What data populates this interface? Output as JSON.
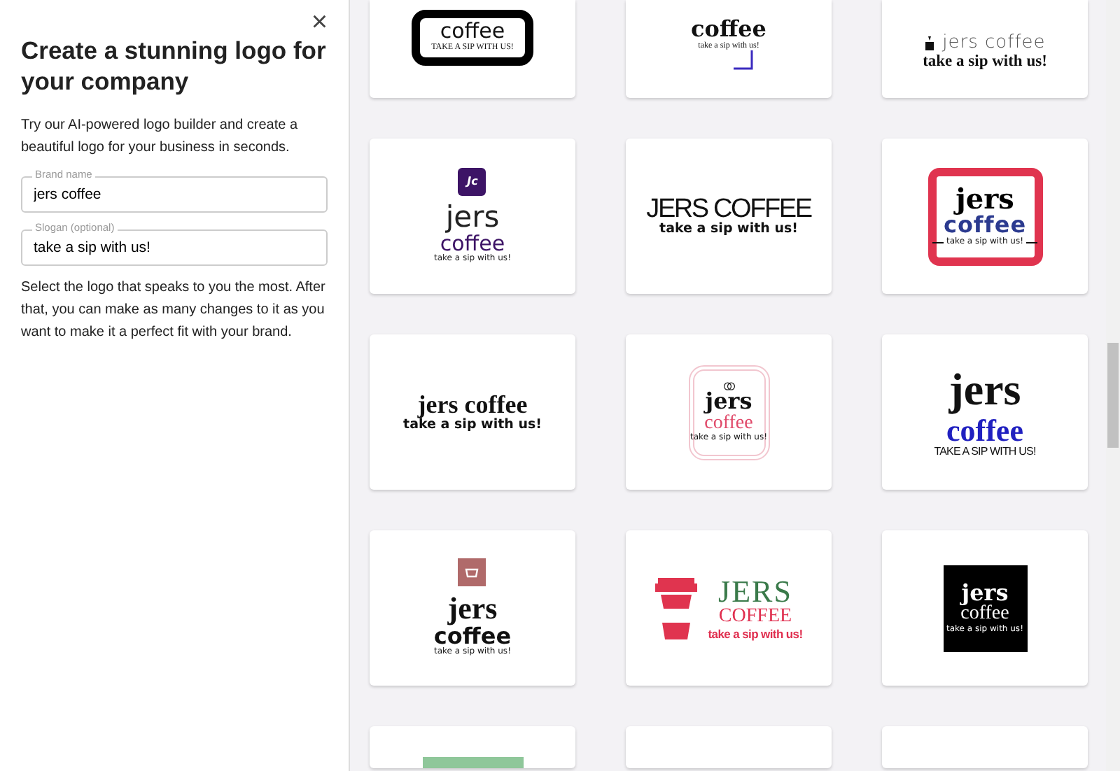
{
  "panel": {
    "close": "×",
    "title": "Create a stunning logo for your company",
    "intro": "Try our AI-powered logo builder and create a beautiful logo for your business in seconds.",
    "fields": [
      {
        "label": "Brand name",
        "value": "jers coffee"
      },
      {
        "label": "Slogan (optional)",
        "value": "take a sip with us!"
      }
    ],
    "instructions": "Select the logo that speaks to you the most. After that, you can make as many changes to it as you want to make it a perfect fit with your brand."
  },
  "logo_rows": [
    {
      "logos": [
        {
          "kind": "frame-black",
          "lines": [
            {
              "text": "coffee",
              "kind": "sans-mid",
              "color": "#111111"
            },
            {
              "text": "TAKE A SIP WITH US!",
              "kind": "tiny-serif",
              "color": "#111111"
            }
          ]
        },
        {
          "kind": "corner-mark",
          "lines": [
            {
              "text": "coffee",
              "kind": "serif-mid",
              "color": "#111111"
            },
            {
              "text": "take a sip with us!",
              "kind": "tiny-serif",
              "color": "#111111"
            }
          ]
        },
        {
          "kind": "inline-cup",
          "lines": [
            {
              "text": "jers coffee",
              "kind": "sans-light",
              "color": "#555555"
            },
            {
              "text": "take a sip with us!",
              "kind": "serif-bold-small",
              "color": "#111111"
            }
          ]
        }
      ]
    },
    {
      "logos": [
        {
          "kind": "badge-jc",
          "badge": "Jc",
          "lines": [
            {
              "text": "jers",
              "kind": "sans-big",
              "color": "#222222"
            },
            {
              "text": "coffee",
              "kind": "sans-mid",
              "color": "#3d1466"
            },
            {
              "text": "take a sip with us!",
              "kind": "tiny-sans",
              "color": "#222222"
            }
          ]
        },
        {
          "kind": "plain",
          "lines": [
            {
              "text": "JERS COFFEE",
              "kind": "condensed",
              "color": "#111111"
            },
            {
              "text": "take a sip with us!",
              "kind": "sans-bold-small",
              "color": "#111111"
            }
          ]
        },
        {
          "kind": "frame-red",
          "lines": [
            {
              "text": "jers",
              "kind": "heavy",
              "color": "#000000"
            },
            {
              "text": "coffee",
              "kind": "heavy-mid",
              "color": "#2b3a8f"
            },
            {
              "text": "take a sip with us!",
              "kind": "tiny-sans",
              "color": "#111111"
            }
          ]
        }
      ]
    },
    {
      "logos": [
        {
          "kind": "plain",
          "lines": [
            {
              "text": "jers coffee",
              "kind": "serif-bold",
              "color": "#111111"
            },
            {
              "text": "take a sip with us!",
              "kind": "sans-bold-small",
              "color": "#111111"
            }
          ]
        },
        {
          "kind": "frame-pink",
          "lines": [
            {
              "text": "jers",
              "kind": "serif-mid",
              "color": "#111111"
            },
            {
              "text": "coffee",
              "kind": "serif-small",
              "color": "#e04a6a"
            },
            {
              "text": "take a sip with us!",
              "kind": "tiny-sans",
              "color": "#111111"
            }
          ]
        },
        {
          "kind": "plain",
          "lines": [
            {
              "text": "jers",
              "kind": "serif-huge",
              "color": "#111111"
            },
            {
              "text": "coffee",
              "kind": "serif-big",
              "color": "#2020c0"
            },
            {
              "text": "TAKE A SIP WITH US!",
              "kind": "tiny-condensed",
              "color": "#111111"
            }
          ]
        }
      ]
    },
    {
      "logos": [
        {
          "kind": "icon-square",
          "lines": [
            {
              "text": "jers",
              "kind": "serif-big",
              "color": "#111111"
            },
            {
              "text": "coffee",
              "kind": "sans-mid-bold",
              "color": "#111111"
            },
            {
              "text": "take a sip with us!",
              "kind": "tiny-sans",
              "color": "#111111"
            }
          ]
        },
        {
          "kind": "cup",
          "lines": [
            {
              "text": "JERS",
              "kind": "serif-big-caps",
              "color": "#3a7a4a"
            },
            {
              "text": "COFFEE",
              "kind": "serif-small",
              "color": "#e03050"
            },
            {
              "text": "take a sip with us!",
              "kind": "sans-bold-tiny",
              "color": "#e03050"
            }
          ]
        },
        {
          "kind": "black-square",
          "lines": [
            {
              "text": "jers",
              "kind": "serif-mid",
              "color": "#ffffff"
            },
            {
              "text": "coffee",
              "kind": "serif-small",
              "color": "#ffffff"
            },
            {
              "text": "take a sip with us!",
              "kind": "tiny-sans",
              "color": "#ffffff"
            }
          ]
        }
      ]
    },
    {
      "logos": [
        {
          "kind": "green-bar"
        },
        {
          "kind": "empty"
        },
        {
          "kind": "empty"
        }
      ]
    }
  ]
}
